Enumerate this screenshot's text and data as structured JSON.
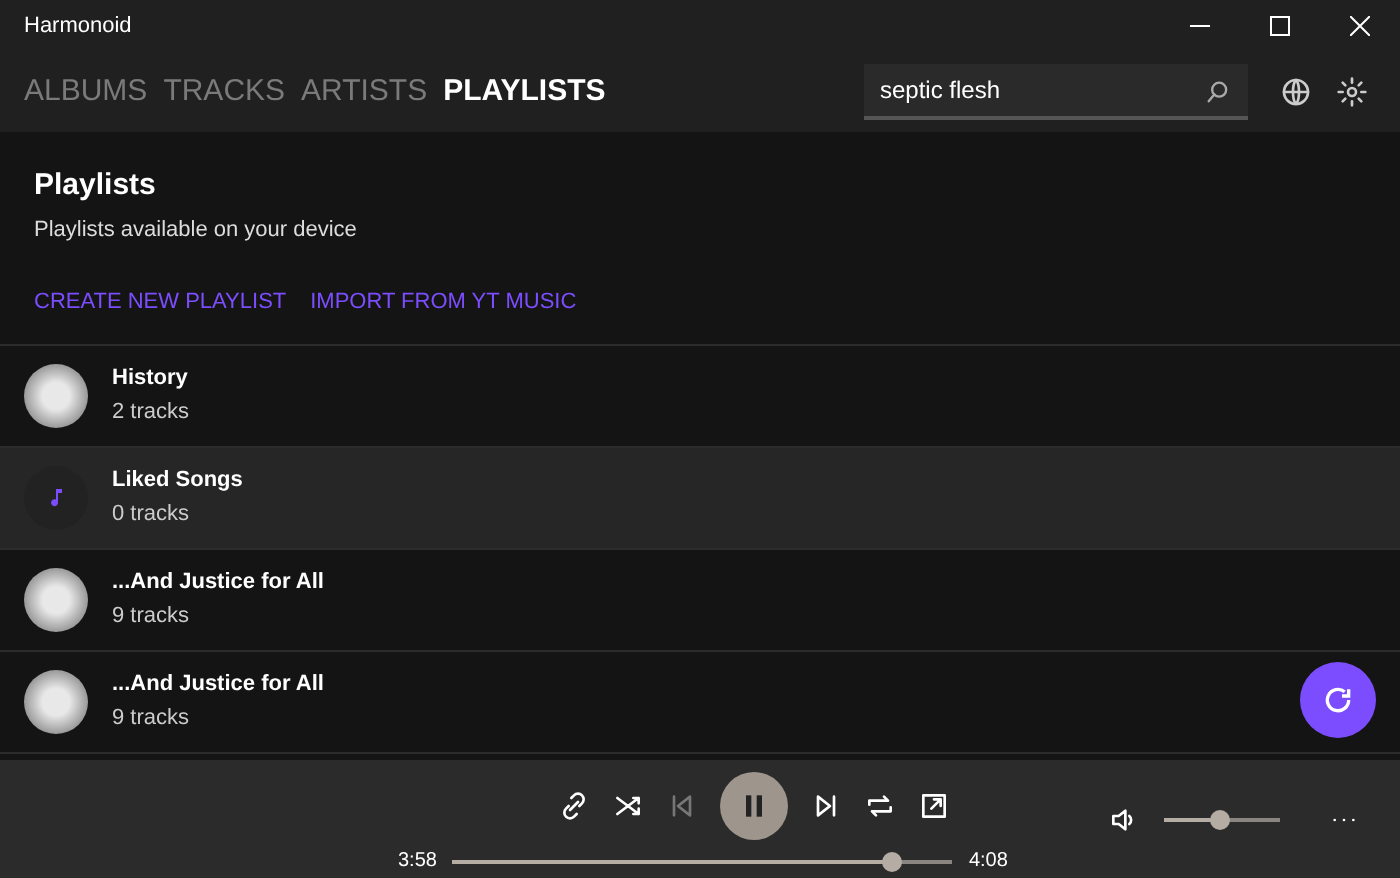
{
  "window": {
    "title": "Harmonoid"
  },
  "tabs": [
    {
      "label": "ALBUMS",
      "selected": false
    },
    {
      "label": "TRACKS",
      "selected": false
    },
    {
      "label": "ARTISTS",
      "selected": false
    },
    {
      "label": "PLAYLISTS",
      "selected": true
    }
  ],
  "search": {
    "value": "septic flesh"
  },
  "header": {
    "title": "Playlists",
    "subtitle": "Playlists available on your device",
    "actions": [
      "CREATE NEW PLAYLIST",
      "IMPORT FROM YT MUSIC"
    ]
  },
  "playlists": [
    {
      "name": "History",
      "count": "2 tracks",
      "kind": "art",
      "selected": false
    },
    {
      "name": "Liked Songs",
      "count": "0 tracks",
      "kind": "liked",
      "selected": true
    },
    {
      "name": "...And Justice for All",
      "count": "9 tracks",
      "kind": "art",
      "selected": false
    },
    {
      "name": "...And Justice for All",
      "count": "9 tracks",
      "kind": "art",
      "selected": false
    }
  ],
  "player": {
    "elapsed": "3:58",
    "duration": "4:08",
    "level": 0.88,
    "volume": {
      "level": 0.48
    }
  }
}
